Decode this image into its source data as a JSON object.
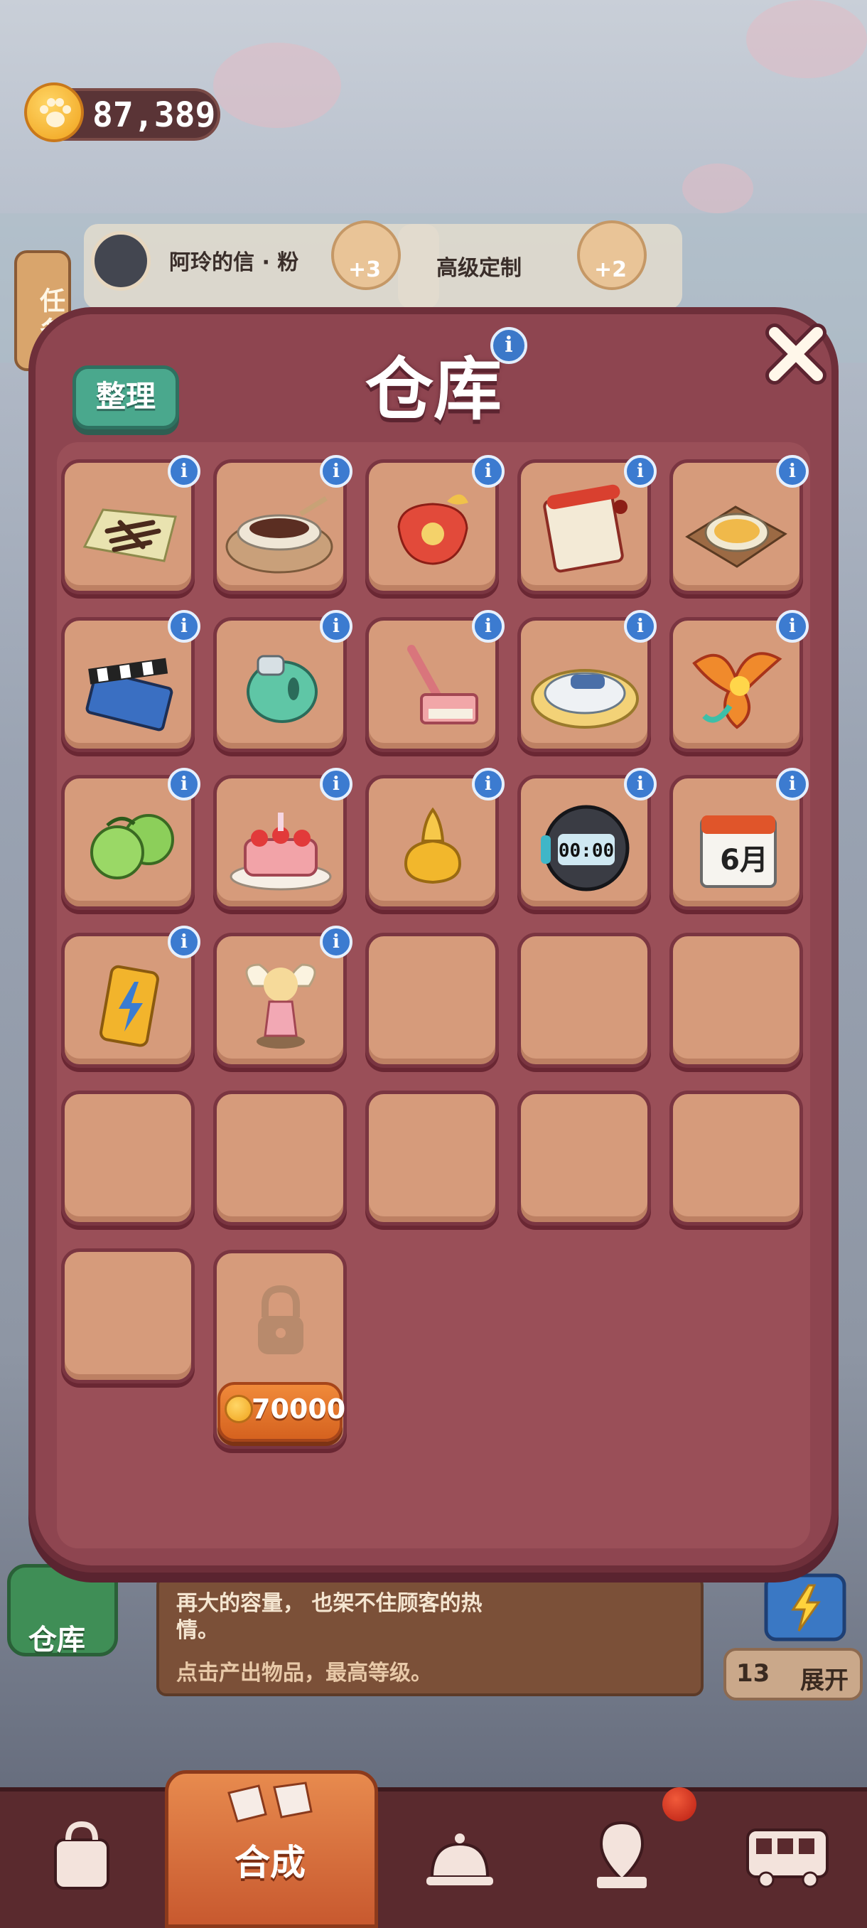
{
  "currency": {
    "paw_coins": "87,389"
  },
  "background": {
    "task_tab_label": "任务",
    "order_customer": "阿玲的信 · 粉",
    "order_title": "高级定制",
    "order_rewards": [
      "+3",
      "+2"
    ]
  },
  "dialog": {
    "title": "仓库",
    "sort_button_label": "整理",
    "slots": [
      {
        "item": "dried-seaweed-strips-icon",
        "has_info": true
      },
      {
        "item": "noodle-bowl-icon",
        "has_info": true
      },
      {
        "item": "red-gift-pouch-icon",
        "has_info": true
      },
      {
        "item": "scroll-banner-icon",
        "has_info": true
      },
      {
        "item": "soup-tray-icon",
        "has_info": true
      },
      {
        "item": "film-clapperboard-icon",
        "has_info": true
      },
      {
        "item": "green-mouse-icon",
        "has_info": true
      },
      {
        "item": "pink-shovel-icon",
        "has_info": true
      },
      {
        "item": "sandwich-press-icon",
        "has_info": true
      },
      {
        "item": "phoenix-icon",
        "has_info": true
      },
      {
        "item": "green-gooseberries-icon",
        "has_info": true
      },
      {
        "item": "strawberry-cake-icon",
        "has_info": true
      },
      {
        "item": "golden-bottle-icon",
        "has_info": true
      },
      {
        "item": "digital-stopwatch-icon",
        "has_info": true
      },
      {
        "item": "calendar-june-icon",
        "has_info": true
      },
      {
        "item": "energy-battery-icon",
        "has_info": true
      },
      {
        "item": "fairy-doll-icon",
        "has_info": true
      },
      {
        "item": "empty",
        "has_info": false
      },
      {
        "item": "empty",
        "has_info": false
      },
      {
        "item": "empty",
        "has_info": false
      },
      {
        "item": "empty",
        "has_info": false
      },
      {
        "item": "empty",
        "has_info": false
      },
      {
        "item": "empty",
        "has_info": false
      },
      {
        "item": "empty",
        "has_info": false
      },
      {
        "item": "empty",
        "has_info": false
      },
      {
        "item": "empty",
        "has_info": false
      }
    ],
    "locked_slot": {
      "price": "70000"
    },
    "calendar_text": "6月",
    "stopwatch_text": "00:00"
  },
  "lower_panel": {
    "desc_line1": "再大的容量， 也架不住顾客的热",
    "desc_line2": "情。",
    "desc_line3": "点击产出物品，最高等级。",
    "storage_label": "仓库",
    "expand_count": "13",
    "expand_label": "展开"
  },
  "nav": {
    "active_label": "合成",
    "items": [
      "shop-bag-icon",
      "merge-icon",
      "service-bell-icon",
      "map-pin-icon",
      "bus-icon"
    ]
  },
  "colors": {
    "dialog_bg": "#8e4550",
    "slot_bg": "#d69b7b",
    "info_badge": "#3c7bd0",
    "sort_button": "#4aa88d",
    "unlock_button": "#e2732d"
  }
}
